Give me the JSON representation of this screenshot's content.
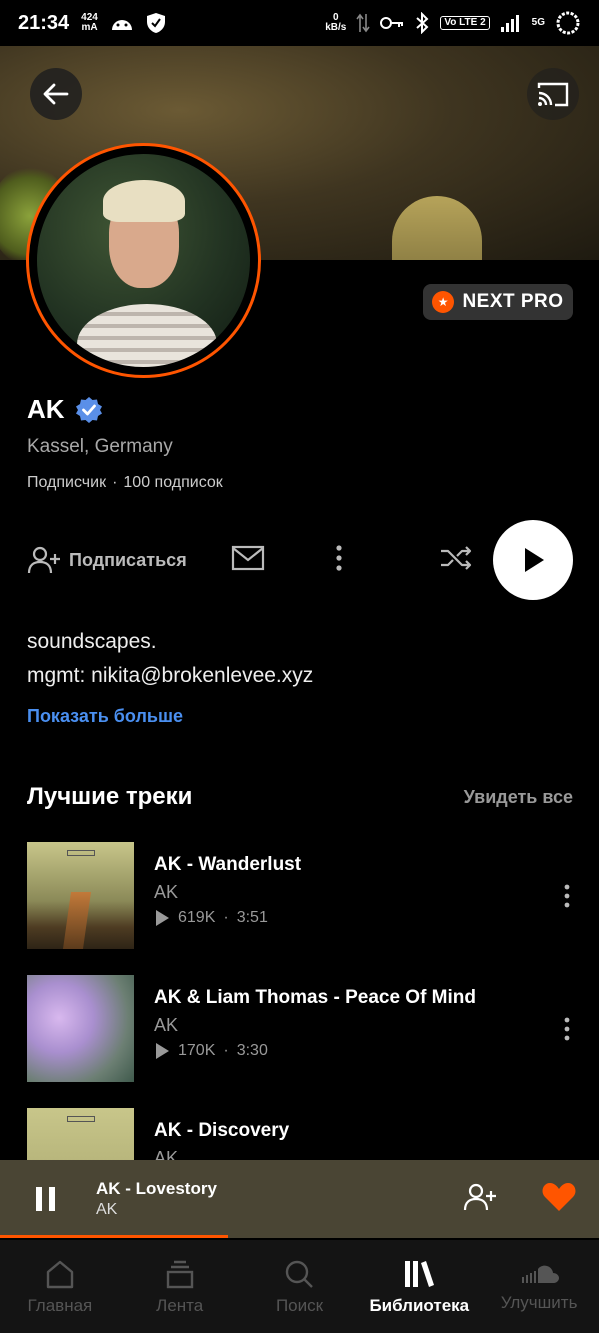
{
  "status_bar": {
    "time": "21:34",
    "data_rate": "424",
    "data_unit": "mA",
    "net_speed": "0",
    "net_unit": "kB/s",
    "lte": "Vo LTE 2",
    "network": "5G"
  },
  "profile": {
    "name": "AK",
    "location": "Kassel, Germany",
    "followers_label": "Подписчик",
    "separator": "·",
    "following_label": "100 подписок",
    "pro_badge": "NEXT PRO",
    "verified": true
  },
  "actions": {
    "follow_label": "Подписаться"
  },
  "bio": {
    "line1": "soundscapes.",
    "line2": "mgmt: nikita@brokenlevee.xyz",
    "show_more": "Показать больше"
  },
  "top_tracks": {
    "title": "Лучшие треки",
    "see_all": "Увидеть все",
    "items": [
      {
        "title": "AK - Wanderlust",
        "artist": "AK",
        "plays": "619K",
        "sep": "·",
        "duration": "3:51"
      },
      {
        "title": "AK & Liam Thomas - Peace Of Mind",
        "artist": "AK",
        "plays": "170K",
        "sep": "·",
        "duration": "3:30"
      },
      {
        "title": "AK - Discovery",
        "artist": "AK",
        "plays": "",
        "sep": "",
        "duration": ""
      }
    ]
  },
  "mini_player": {
    "title": "AK - Lovestory",
    "artist": "AK",
    "progress": 0.38
  },
  "nav": {
    "items": [
      {
        "label": "Главная",
        "icon": "home-icon"
      },
      {
        "label": "Лента",
        "icon": "feed-icon"
      },
      {
        "label": "Поиск",
        "icon": "search-icon"
      },
      {
        "label": "Библиотека",
        "icon": "library-icon"
      },
      {
        "label": "Улучшить",
        "icon": "soundcloud-icon"
      }
    ],
    "active_index": 3
  },
  "colors": {
    "accent": "#ff5500",
    "link": "#4a8ff0",
    "verified": "#5a8fe8"
  }
}
